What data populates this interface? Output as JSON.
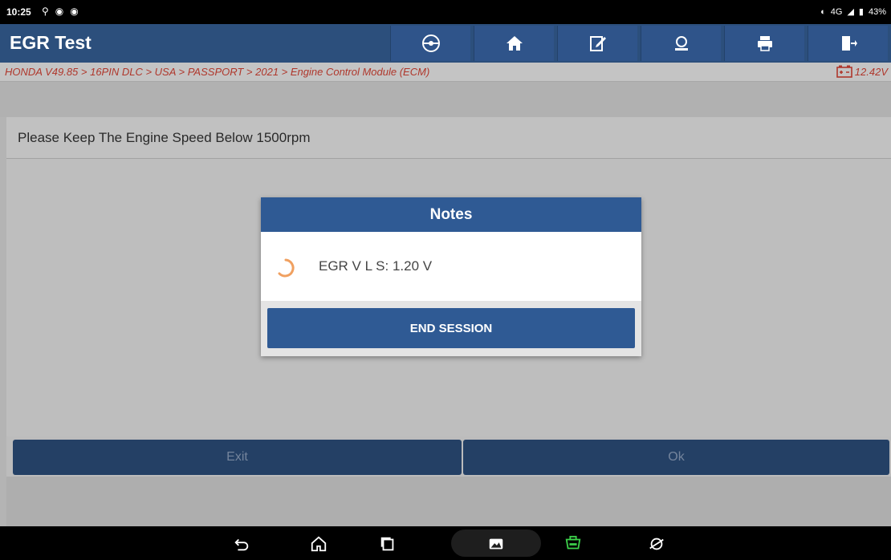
{
  "status_bar": {
    "time": "10:25",
    "network": "4G",
    "battery": "43%"
  },
  "header": {
    "title": "EGR Test"
  },
  "breadcrumb": {
    "path": "HONDA V49.85 > 16PIN DLC > USA > PASSPORT > 2021 > Engine Control Module (ECM)",
    "voltage": "12.42V"
  },
  "message": "Please Keep The Engine Speed Below 1500rpm",
  "dialog": {
    "title": "Notes",
    "text": "EGR V L S: 1.20 V",
    "button": "END SESSION"
  },
  "buttons": {
    "exit": "Exit",
    "ok": "Ok"
  },
  "colors": {
    "header": "#2c4f7c",
    "dialog_header": "#2f5a94",
    "accent_red": "#d64436",
    "spinner": "#f0a060",
    "vci_green": "#3cd04a"
  }
}
